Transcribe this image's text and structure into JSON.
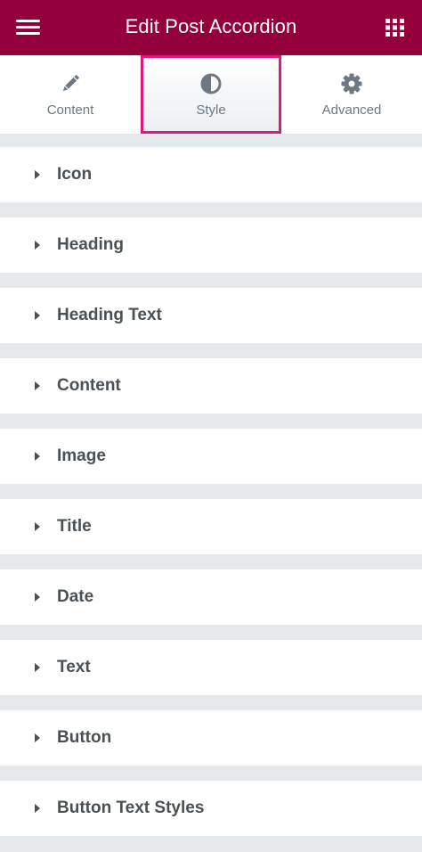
{
  "header": {
    "title": "Edit Post Accordion",
    "menu_icon": "hamburger-menu-icon",
    "apps_icon": "grid-apps-icon",
    "background_color": "#93003c"
  },
  "tabs": [
    {
      "label": "Content",
      "icon": "pencil-icon",
      "active": false
    },
    {
      "label": "Style",
      "icon": "contrast-circle-icon",
      "active": true
    },
    {
      "label": "Advanced",
      "icon": "gear-icon",
      "active": false
    }
  ],
  "active_tab_outline_color": "#e2177c",
  "sections": [
    {
      "label": "Icon"
    },
    {
      "label": "Heading"
    },
    {
      "label": "Heading Text"
    },
    {
      "label": "Content"
    },
    {
      "label": "Image"
    },
    {
      "label": "Title"
    },
    {
      "label": "Date"
    },
    {
      "label": "Text"
    },
    {
      "label": "Button"
    },
    {
      "label": "Button Text Styles"
    }
  ]
}
